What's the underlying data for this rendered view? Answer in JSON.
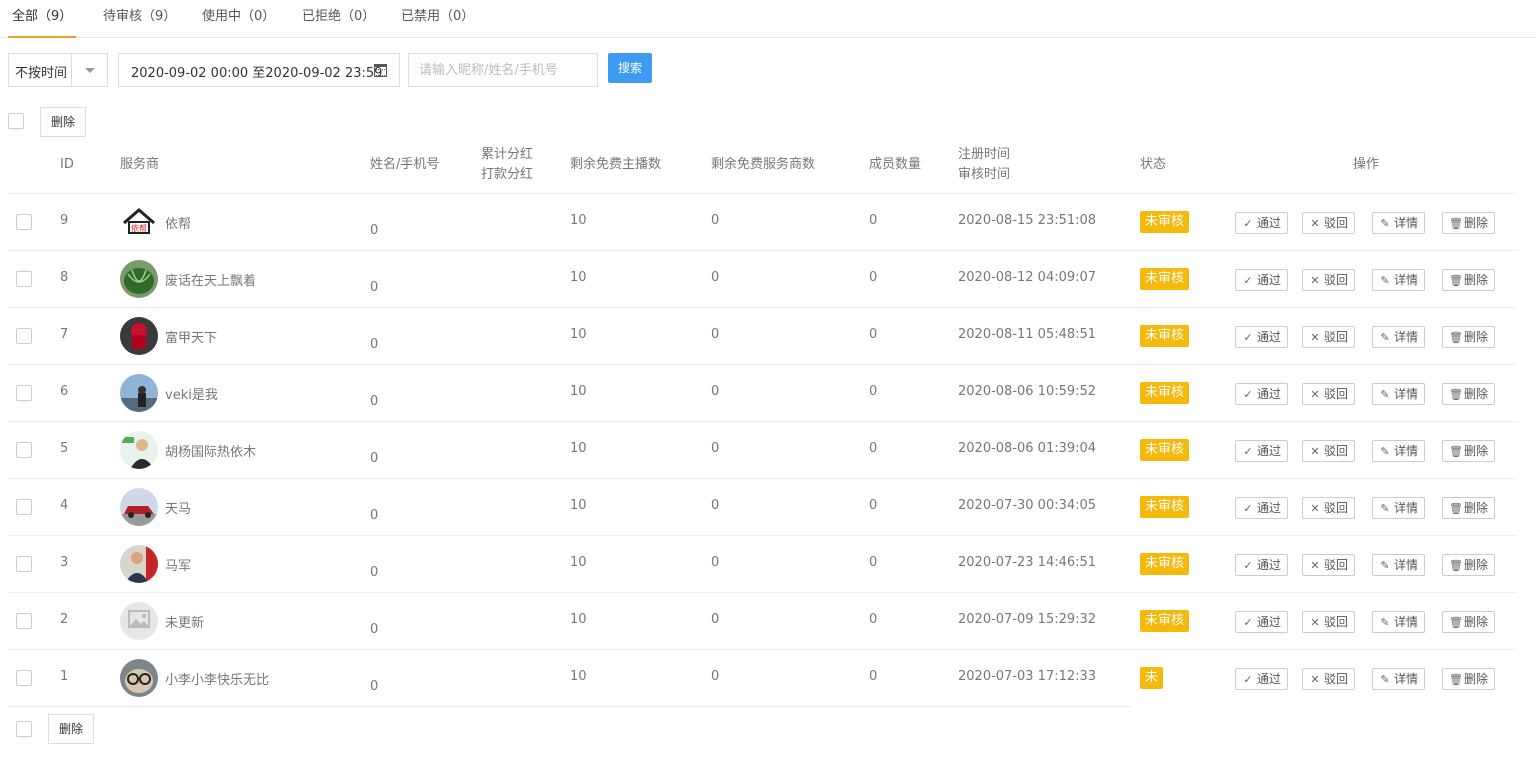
{
  "tabs": [
    {
      "label": "全部（9）"
    },
    {
      "label": "待审核（9）"
    },
    {
      "label": "使用中（0）"
    },
    {
      "label": "已拒绝（0）"
    },
    {
      "label": "已禁用（0）"
    }
  ],
  "filters": {
    "time_select": "不按时间",
    "date_range": "2020-09-02 00:00 至2020-09-02 23:59",
    "search_placeholder": "请输入昵称/姓名/手机号",
    "search_button": "搜索"
  },
  "delete_label": "删除",
  "columns": {
    "id": "ID",
    "provider": "服务商",
    "name_phone": "姓名/手机号",
    "dividend_line1": "累计分红",
    "dividend_line2": "打款分红",
    "free_anchors": "剩余免费主播数",
    "free_providers": "剩余免费服务商数",
    "members": "成员数量",
    "time_line1": "注册时间",
    "time_line2": "审核时间",
    "status": "状态",
    "actions": "操作"
  },
  "actions": {
    "approve": "通过",
    "reject": "驳回",
    "detail": "详情",
    "delete": "删除"
  },
  "rows": [
    {
      "id": "9",
      "name": "依帮",
      "dividend": "0",
      "free_anchors": "10",
      "free_providers": "0",
      "members": "0",
      "time": "2020-08-15 23:51:08",
      "status": "未审核",
      "avatar": "house-logo"
    },
    {
      "id": "8",
      "name": "废话在天上飘着",
      "dividend": "0",
      "free_anchors": "10",
      "free_providers": "0",
      "members": "0",
      "time": "2020-08-12 04:09:07",
      "status": "未审核",
      "avatar": "watermelon"
    },
    {
      "id": "7",
      "name": "富甲天下",
      "dividend": "0",
      "free_anchors": "10",
      "free_providers": "0",
      "members": "0",
      "time": "2020-08-11 05:48:51",
      "status": "未审核",
      "avatar": "red-object"
    },
    {
      "id": "6",
      "name": "veki是我",
      "dividend": "0",
      "free_anchors": "10",
      "free_providers": "0",
      "members": "0",
      "time": "2020-08-06 10:59:52",
      "status": "未审核",
      "avatar": "person-sky"
    },
    {
      "id": "5",
      "name": "胡杨国际热依木",
      "dividend": "0",
      "free_anchors": "10",
      "free_providers": "0",
      "members": "0",
      "time": "2020-08-06 01:39:04",
      "status": "未审核",
      "avatar": "person-suit"
    },
    {
      "id": "4",
      "name": "天马",
      "dividend": "0",
      "free_anchors": "10",
      "free_providers": "0",
      "members": "0",
      "time": "2020-07-30 00:34:05",
      "status": "未审核",
      "avatar": "red-car"
    },
    {
      "id": "3",
      "name": "马军",
      "dividend": "0",
      "free_anchors": "10",
      "free_providers": "0",
      "members": "0",
      "time": "2020-07-23 14:46:51",
      "status": "未审核",
      "avatar": "person-flag"
    },
    {
      "id": "2",
      "name": "未更新",
      "dividend": "0",
      "free_anchors": "10",
      "free_providers": "0",
      "members": "0",
      "time": "2020-07-09 15:29:32",
      "status": "未审核",
      "avatar": "image-placeholder"
    },
    {
      "id": "1",
      "name": "小李小李快乐无比",
      "dividend": "0",
      "free_anchors": "10",
      "free_providers": "0",
      "members": "0",
      "time": "2020-07-03 17:12:33",
      "status": "未审核",
      "avatar": "glasses-face"
    }
  ]
}
